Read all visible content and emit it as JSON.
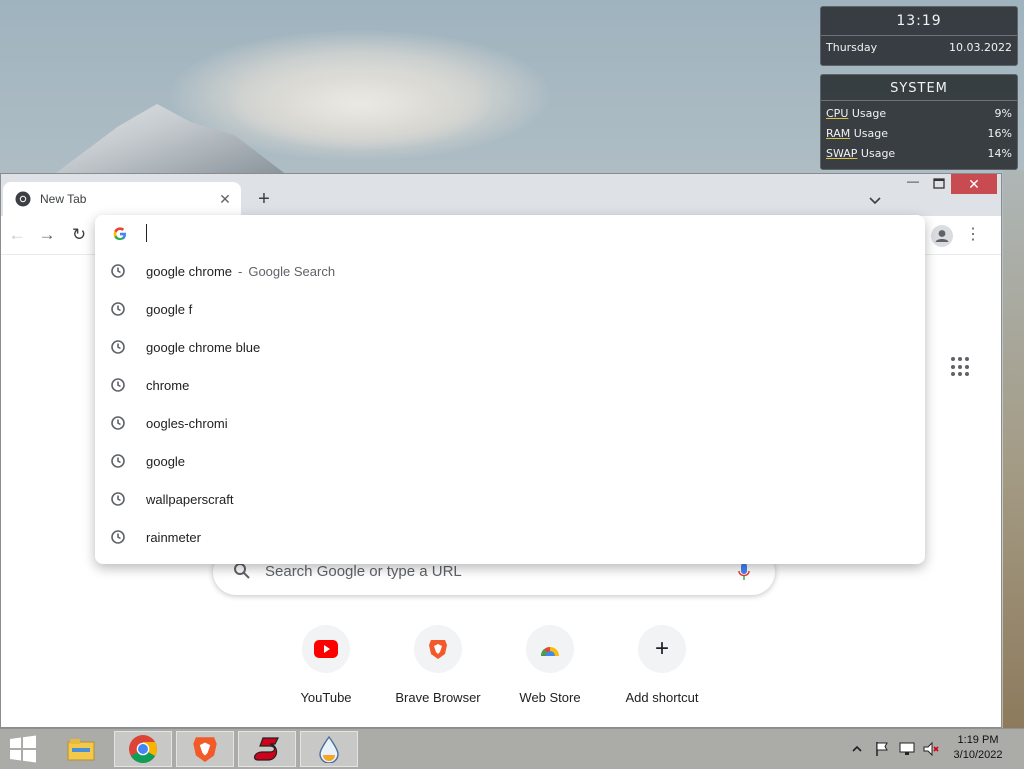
{
  "widgets": {
    "clock": {
      "time": "13:19",
      "day": "Thursday",
      "date": "10.03.2022"
    },
    "system": {
      "title": "SYSTEM",
      "rows": [
        {
          "label_a": "CPU",
          "label_b": " Usage",
          "value": "9%"
        },
        {
          "label_a": "RAM",
          "label_b": " Usage",
          "value": "16%"
        },
        {
          "label_a": "SWAP",
          "label_b": " Usage",
          "value": "14%"
        }
      ]
    }
  },
  "browser": {
    "tab_title": "New Tab",
    "omnibox": {
      "value": "",
      "suggestions": [
        {
          "text": "google chrome",
          "sep": "-",
          "desc": "Google Search"
        },
        {
          "text": "google f",
          "sep": "",
          "desc": ""
        },
        {
          "text": "google chrome blue",
          "sep": "",
          "desc": ""
        },
        {
          "text": "chrome",
          "sep": "",
          "desc": ""
        },
        {
          "text": "oogles-chromi",
          "sep": "",
          "desc": ""
        },
        {
          "text": "google",
          "sep": "",
          "desc": ""
        },
        {
          "text": "wallpaperscraft",
          "sep": "",
          "desc": ""
        },
        {
          "text": "rainmeter",
          "sep": "",
          "desc": ""
        }
      ]
    },
    "ntp": {
      "search_placeholder": "Search Google or type a URL",
      "shortcuts": [
        {
          "label": "YouTube",
          "icon": "youtube-icon"
        },
        {
          "label": "Brave Browser",
          "icon": "brave-icon"
        },
        {
          "label": "Web Store",
          "icon": "webstore-icon"
        },
        {
          "label": "Add shortcut",
          "icon": "plus-icon"
        }
      ]
    }
  },
  "taskbar": {
    "items": [
      "file-explorer-icon",
      "chrome-icon",
      "brave-icon",
      "app-s-icon",
      "drop-app-icon"
    ],
    "clock_time": "1:19 PM",
    "clock_date": "3/10/2022"
  },
  "colors": {
    "close_button": "#c74b50",
    "youtube_red": "#ff0000",
    "brave_orange": "#f25a29",
    "google_blue": "#4285f4"
  }
}
